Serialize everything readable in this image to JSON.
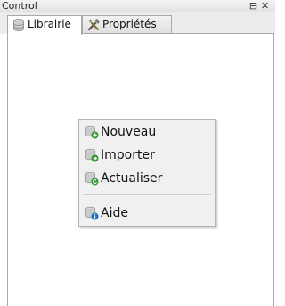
{
  "window": {
    "title": "Control",
    "restore_glyph": "⊟",
    "close_glyph": "✕"
  },
  "tabs": [
    {
      "label": "Librairie",
      "icon": "database-icon",
      "active": true
    },
    {
      "label": "Propriétés",
      "icon": "tools-icon",
      "active": false
    }
  ],
  "context_menu": {
    "items": [
      {
        "label": "Nouveau",
        "icon": "db-add-icon"
      },
      {
        "label": "Importer",
        "icon": "db-import-icon"
      },
      {
        "label": "Actualiser",
        "icon": "db-refresh-icon"
      },
      {
        "label": "Aide",
        "icon": "db-help-icon"
      }
    ]
  },
  "colors": {
    "titlebar": "#e6e6e6",
    "menu_bg": "#f0f0f0",
    "border": "#a9a9a9",
    "icon_green": "#2e9a2e",
    "icon_blue": "#1f6fc4"
  }
}
